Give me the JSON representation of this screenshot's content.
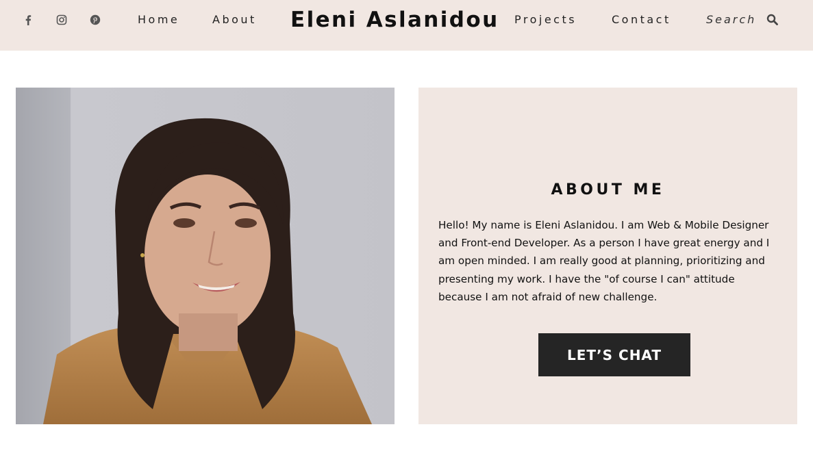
{
  "header": {
    "social": [
      {
        "name": "facebook-icon"
      },
      {
        "name": "instagram-icon"
      },
      {
        "name": "pinterest-icon"
      }
    ],
    "nav": {
      "home": "Home",
      "about": "About",
      "projects": "Projects",
      "contact": "Contact"
    },
    "brand": "Eleni Aslanidou",
    "search_label": "Search",
    "search_icon": "search-icon",
    "background_color": "#f1e7e2"
  },
  "main": {
    "photo": {
      "icon": "profile-photo",
      "alt": ""
    },
    "about": {
      "title": "ABOUT ME",
      "text": "Hello! My name is Eleni Aslanidou. I am Web & Mobile Designer and Front-end Developer. As a person I have great energy and I am open minded. I am really good at planning, prioritizing and presenting my work. I have the \"of course I can\" attitude because I am not afraid of new challenge.",
      "cta_label": "LET’S CHAT",
      "cta_color": "#252525"
    }
  }
}
